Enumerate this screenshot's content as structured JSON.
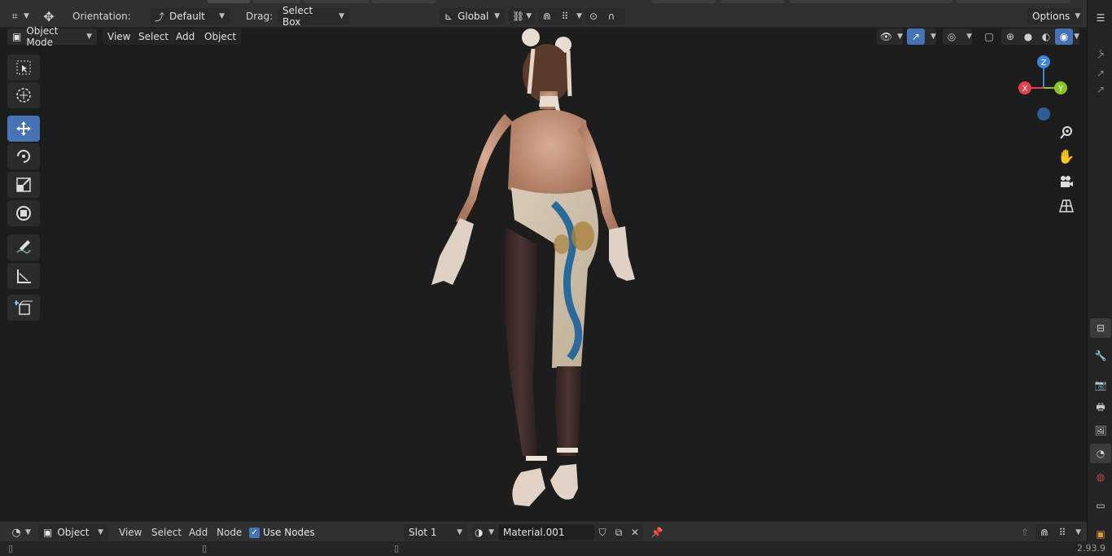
{
  "header": {
    "orientation_label": "Orientation:",
    "orientation_value": "Default",
    "drag_label": "Drag:",
    "drag_value": "Select Box",
    "transform_space": "Global",
    "options_label": "Options"
  },
  "viewport_header": {
    "mode": "Object Mode",
    "menus": [
      "View",
      "Select",
      "Add",
      "Object"
    ]
  },
  "toolbar": {
    "tools": [
      "select-box",
      "cursor",
      "move",
      "rotate",
      "scale",
      "transform",
      "annotate",
      "measure",
      "add-cube"
    ],
    "active": "move"
  },
  "gizmo": {
    "z": "Z",
    "x": "X",
    "y": "Y"
  },
  "bottom_header": {
    "object_type": "Object",
    "menus": [
      "View",
      "Select",
      "Add",
      "Node"
    ],
    "use_nodes_label": "Use Nodes",
    "use_nodes_checked": true,
    "slot": "Slot 1",
    "material_name": "Material.001"
  },
  "status": {
    "version": "2.93.9"
  },
  "colors": {
    "accent": "#4772b3",
    "axis_x": "#e5404f",
    "axis_y": "#89c32a",
    "axis_z": "#3e88d9"
  }
}
